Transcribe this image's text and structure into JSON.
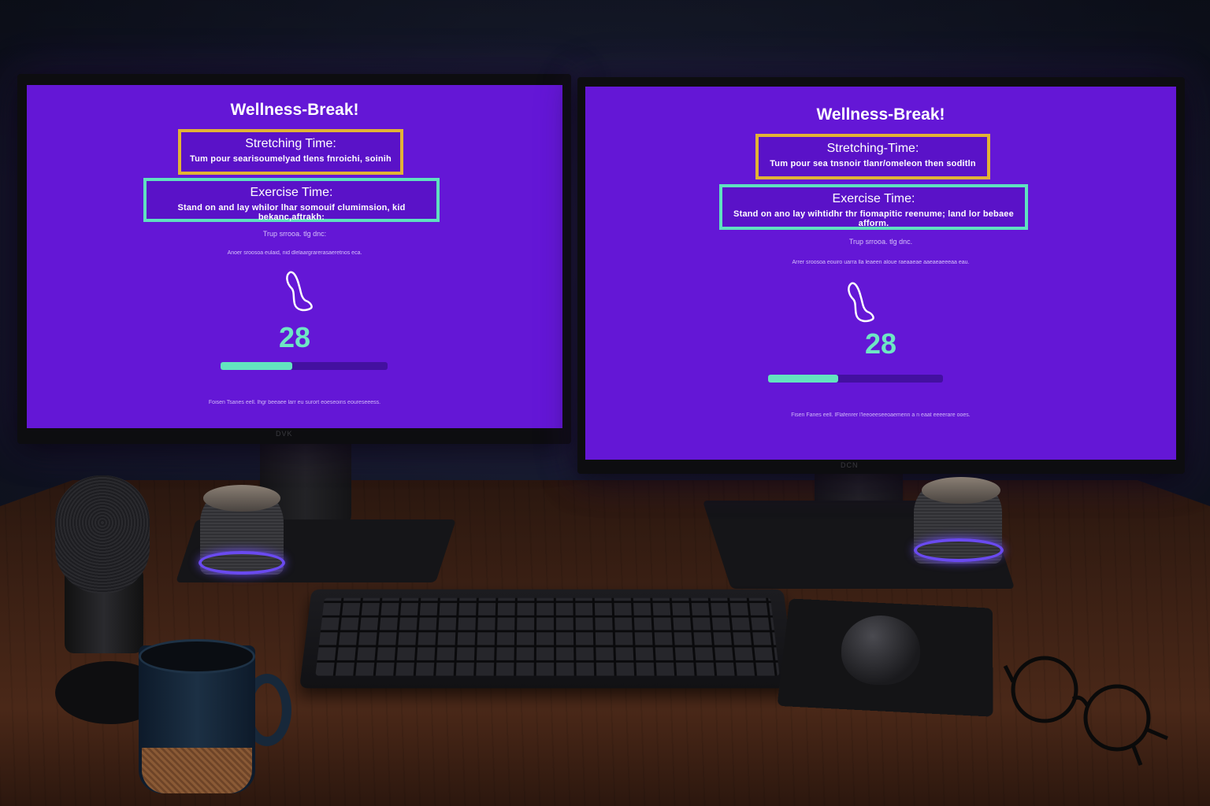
{
  "screens": [
    {
      "title": "Wellness-Break!",
      "stretching": {
        "heading": "Stretching Time:",
        "text": "Tum pour searisoumelyad tlens fnroichi, soinih"
      },
      "exercise": {
        "heading": "Exercise Time:",
        "text": "Stand on and lay whilor lhar somouif clumimsion, kid bekanc,aftrakh:"
      },
      "note_1": "Trup srrooa. tlg dnc:",
      "note_2": "Anoer sroosoa eulaid, nid dlelaargrarerasaeretnos eca.",
      "icon": "foot-icon",
      "countdown": "28",
      "progress": 0.43,
      "footer": "Foisen Tsanes eell. lhgr beeaee larr eu surort eoeseoins eoureseeess.",
      "brand": "DVK"
    },
    {
      "title": "Wellness-Break!",
      "stretching": {
        "heading": "Stretching-Time:",
        "text": "Tum pour sea tnsnoir tlanr/omeleon then soditln"
      },
      "exercise": {
        "heading": "Exercise Time:",
        "text": "Stand on ano lay wihtidhr thr fiomapitic reenume; land lor bebaee afform."
      },
      "note_1": "Trup srrooa. tlg dnc.",
      "note_2": "Arrer sroosoa eouiro uarra lla leaeen aloue raeaaeae aaeaeaeeeaa eau.",
      "icon": "foot-icon",
      "countdown": "28",
      "progress": 0.4,
      "footer": "Fisen Fanes eell. lFlafenrer l'leeoeeseeoaemenn a n eaat eeeerare ooes.",
      "brand": "DCN"
    }
  ],
  "colors": {
    "screen_bg": "#6417d6",
    "stretch_border": "#e2b335",
    "exercise_border": "#5fe0c0",
    "countdown": "#6ee6c4",
    "progress_fill": "#63e3bf",
    "progress_track": "#4310a0"
  }
}
